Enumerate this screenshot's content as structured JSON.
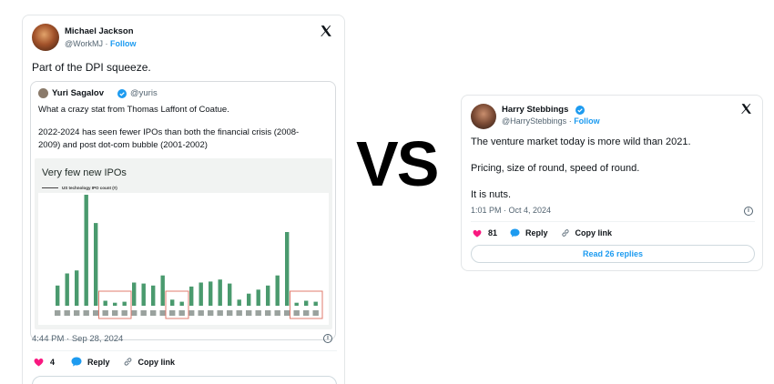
{
  "left_tweet": {
    "author": {
      "name": "Michael Jackson",
      "handle": "@WorkMJ",
      "follow_label": "Follow"
    },
    "text": "Part of the DPI squeeze.",
    "quoted": {
      "author_name": "Yuri Sagalov",
      "author_handle": "@yuris",
      "lines": [
        "What a crazy stat from Thomas Laffont of Coatue.",
        "2022-2024 has seen fewer IPOs than both the financial crisis (2008-",
        "2009) and post dot-com bubble (2001-2002)"
      ],
      "chart_title": "Very few new IPOs",
      "chart_legend": "US technology IPO count (#)"
    },
    "timestamp": "4:44 PM · Sep 28, 2024",
    "likes": "4",
    "reply_label": "Reply",
    "copy_label": "Copy link"
  },
  "vs_text": "VS",
  "right_tweet": {
    "author": {
      "name": "Harry Stebbings",
      "handle": "@HarryStebbings",
      "follow_label": "Follow"
    },
    "lines": [
      "The venture market today is more wild than 2021.",
      "Pricing, size of round, speed of round.",
      "It is nuts."
    ],
    "timestamp": "1:01 PM · Oct 4, 2024",
    "likes": "81",
    "reply_label": "Reply",
    "copy_label": "Copy link",
    "read_replies_label": "Read 26 replies"
  },
  "colors": {
    "verified": "#1d9bf0",
    "like": "#f91880",
    "reply": "#1d9bf0",
    "bar": "#4a9a6e",
    "highlight": "#e07b6e"
  },
  "chart_data": {
    "type": "bar",
    "title": "Very few new IPOs",
    "legend": "US technology IPO count (#)",
    "values": [
      20,
      32,
      35,
      110,
      82,
      5,
      3,
      4,
      23,
      22,
      20,
      30,
      6,
      4,
      19,
      23,
      24,
      26,
      22,
      6,
      12,
      16,
      20,
      30,
      73,
      3,
      5,
      4
    ],
    "highlight_groups": [
      [
        5,
        7
      ],
      [
        12,
        13
      ],
      [
        25,
        27
      ]
    ]
  }
}
